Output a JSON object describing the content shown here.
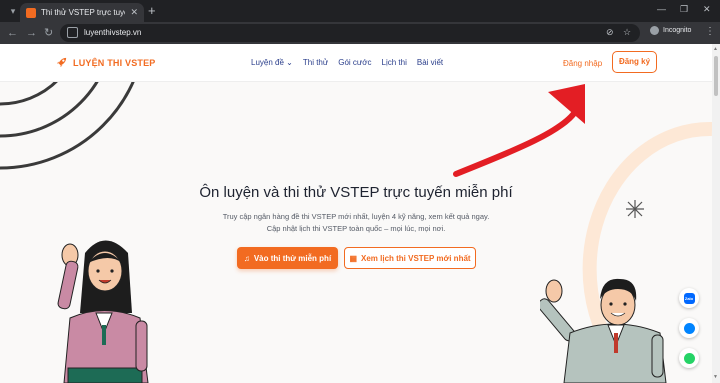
{
  "browser": {
    "tab_title": "Thi thử VSTEP trực tuyến miễn",
    "url": "luyenthivstep.vn",
    "incognito_label": "Incognito"
  },
  "header": {
    "brand": "LUYỆN THI VSTEP",
    "nav": [
      "Luyện đề",
      "Thi thử",
      "Gói cước",
      "Lịch thi",
      "Bài viết"
    ],
    "login": "Đăng nhập",
    "register": "Đăng ký"
  },
  "hero": {
    "title": "Ôn luyện và thi thử VSTEP trực tuyến miễn phí",
    "subtitle_line1": "Truy cập ngân hàng đề thi VSTEP mới nhất, luyện 4 kỹ năng, xem kết quả ngay.",
    "subtitle_line2": "Cập nhật lịch thi VSTEP toàn quốc – mọi lúc, mọi nơi.",
    "primary_button": "Vào thi thử miễn phí",
    "secondary_button": "Xem lịch thi VSTEP mới nhất"
  },
  "floating": {
    "zalo": "Zalo"
  },
  "colors": {
    "accent": "#f26b21",
    "nav_text": "#2b3f8c",
    "annotation_arrow": "#e31e24"
  }
}
